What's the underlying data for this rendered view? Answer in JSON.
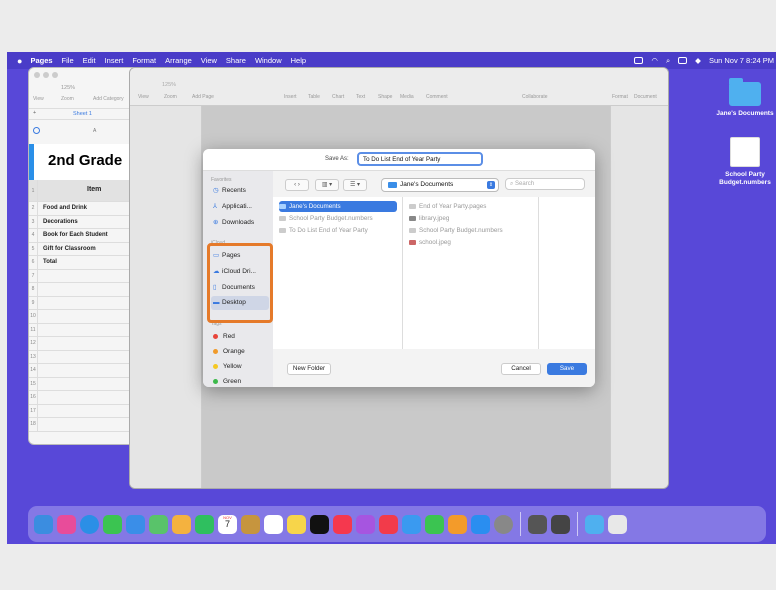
{
  "menubar": {
    "items": [
      "Pages",
      "File",
      "Edit",
      "Insert",
      "Format",
      "Arrange",
      "View",
      "Share",
      "Window",
      "Help"
    ],
    "datetime": "Sun Nov 7  8:24 PM"
  },
  "desktop": {
    "icons": [
      {
        "label": "Jane's Documents"
      },
      {
        "label": "School Party Budget.numbers"
      }
    ]
  },
  "spreadsheet": {
    "toolbar": [
      "View",
      "Zoom",
      "Add Category"
    ],
    "zoom": "125%",
    "sheet_tab": "Sheet 1",
    "column": "A",
    "title": "2nd Grade",
    "header": "Item",
    "rows": [
      "Food  and Drink",
      "Decorations",
      "Book for Each Student",
      "Gift for Classroom",
      "Total"
    ],
    "row_numbers": [
      "1",
      "2",
      "3",
      "4",
      "5",
      "6",
      "7",
      "8",
      "9",
      "10",
      "11",
      "12",
      "13",
      "14",
      "15",
      "16",
      "17",
      "18"
    ]
  },
  "pages_toolbar": {
    "items": [
      "View",
      "Zoom",
      "Add Page",
      "Insert",
      "Table",
      "Chart",
      "Text",
      "Shape",
      "Media",
      "Comment",
      "Collaborate",
      "Format",
      "Document"
    ],
    "zoom": "125%"
  },
  "save_dialog": {
    "save_as_label": "Save As:",
    "filename": "To Do List End of Year Party",
    "sidebar": {
      "favorites_heading": "Favorites",
      "favorites": [
        "Recents",
        "Applicati...",
        "Downloads"
      ],
      "icloud_heading": "iCloud",
      "icloud": [
        "Pages",
        "iCloud Dri...",
        "Documents",
        "Desktop"
      ],
      "tags_heading": "Tags",
      "tags": [
        {
          "label": "Red",
          "color": "#e8443a"
        },
        {
          "label": "Orange",
          "color": "#f09a2a"
        },
        {
          "label": "Yellow",
          "color": "#f5c823"
        },
        {
          "label": "Green",
          "color": "#3cb94a"
        }
      ]
    },
    "location": "Jane's Documents",
    "search_placeholder": "Search",
    "col1": [
      "Jane's Documents",
      "School Party Budget.numbers",
      "To Do List End of Year Party"
    ],
    "col2": [
      "End of Year Party.pages",
      "library.jpeg",
      "School Party Budget.numbers",
      "school.jpeg"
    ],
    "new_folder": "New Folder",
    "cancel": "Cancel",
    "save": "Save"
  },
  "highlight_color": "#e57a2a",
  "dock": {
    "calendar_month": "NOV",
    "calendar_day": "7"
  }
}
